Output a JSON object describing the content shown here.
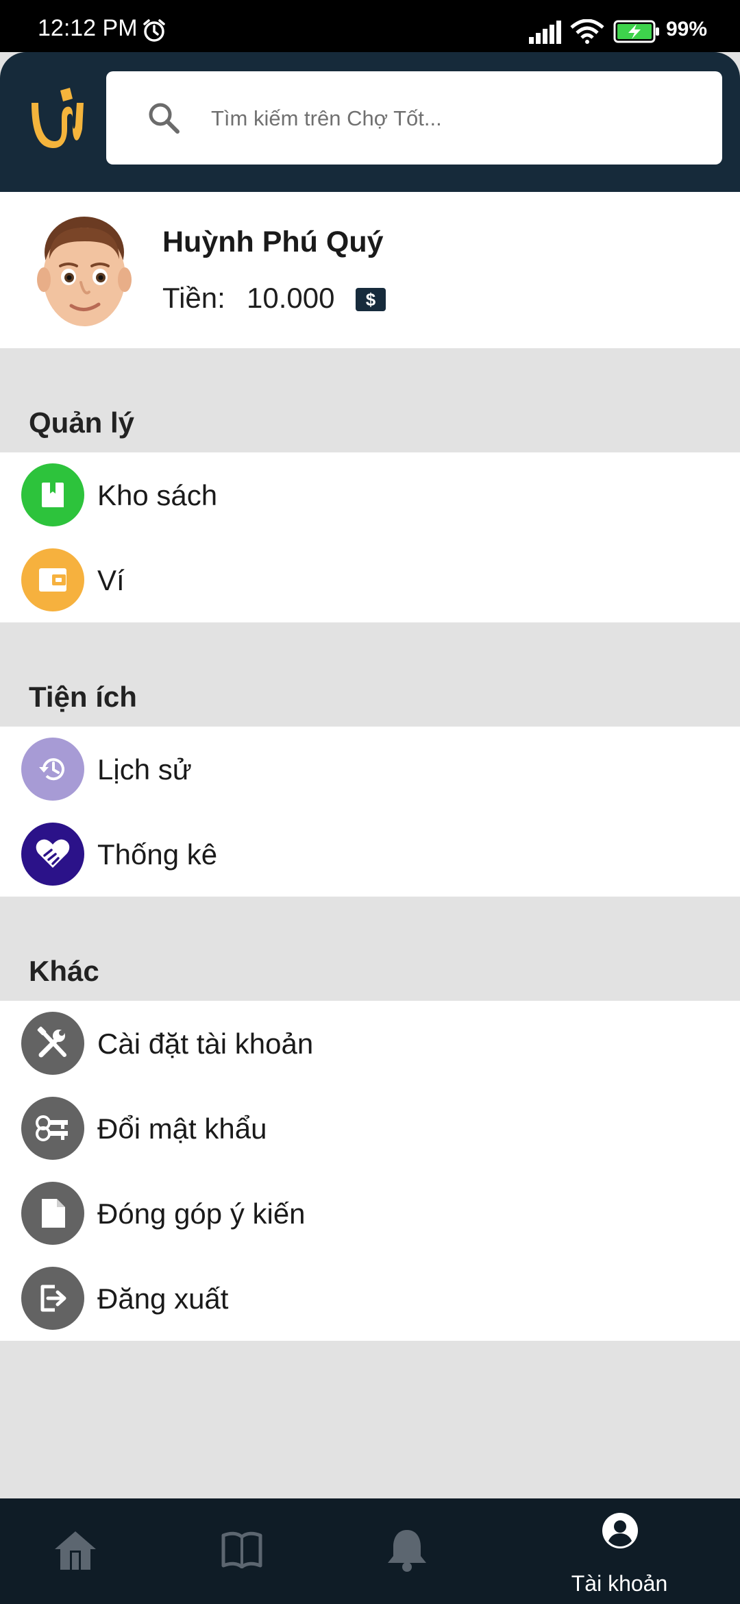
{
  "status_bar": {
    "time": "12:12 PM",
    "battery_percent": "99%",
    "icons": [
      "alarm-icon",
      "signal-icon",
      "wifi-icon",
      "battery-charging-icon"
    ]
  },
  "header": {
    "logo": "app-logo",
    "search": {
      "placeholder": "Tìm kiếm trên Chợ Tốt..."
    }
  },
  "profile": {
    "name": "Huỳnh Phú Quý",
    "balance_label": "Tiền:",
    "balance_value": "10.000",
    "currency_icon": "$"
  },
  "sections": [
    {
      "title": "Quản lý",
      "items": [
        {
          "label": "Kho sách",
          "icon": "bookmark-icon",
          "color": "#2dc33c"
        },
        {
          "label": "Ví",
          "icon": "wallet-icon",
          "color": "#f6b13e"
        }
      ]
    },
    {
      "title": "Tiện ích",
      "items": [
        {
          "label": "Lịch sử",
          "icon": "history-icon",
          "color": "#a79bd5"
        },
        {
          "label": "Thống kê",
          "icon": "handshake-heart-icon",
          "color": "#2b1289"
        }
      ]
    },
    {
      "title": "Khác",
      "items": [
        {
          "label": "Cài đặt tài khoản",
          "icon": "tools-icon",
          "color": "#636363"
        },
        {
          "label": "Đổi mật khẩu",
          "icon": "key-icon",
          "color": "#636363"
        },
        {
          "label": "Đóng góp ý kiến",
          "icon": "document-icon",
          "color": "#636363"
        },
        {
          "label": "Đăng xuất",
          "icon": "logout-icon",
          "color": "#636363"
        }
      ]
    }
  ],
  "bottom_nav": {
    "items": [
      {
        "icon": "home-icon",
        "label": ""
      },
      {
        "icon": "book-icon",
        "label": ""
      },
      {
        "icon": "bell-icon",
        "label": ""
      },
      {
        "icon": "account-icon",
        "label": "Tài khoản",
        "active": true
      }
    ]
  },
  "colors": {
    "header_bg": "#162a3a",
    "nav_bg": "#0f1c26",
    "page_bg": "#e2e2e2"
  }
}
